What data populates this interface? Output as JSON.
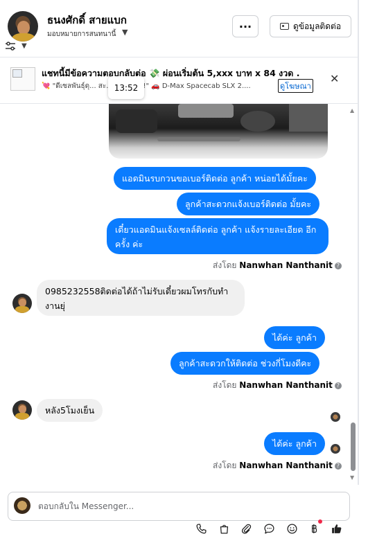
{
  "header": {
    "name": "ธนงศักดิ์ สายแบก",
    "subtitle": "มอบหมายการสนทนานี้",
    "more_label": "···",
    "contact_label": "ดูข้อมูลติดต่อ"
  },
  "ad": {
    "title": "แชทนี้มีข้อความตอบกลับต่อ 💸 ผ่อนเริ่มต้น 5,xxx บาท x 84 งวด .",
    "subtitle": "💘 \"ดีเซลพันธุ์ดุ... สะ... ...ค้าดูถูก!\" 🚗 D-Max Spacecab SLX 2....",
    "link_label": "ดูโฆษณา",
    "close_label": "✕",
    "tooltip_time": "13:52"
  },
  "messages": {
    "out1": "แอดมินรบกวนขอเบอร์ติดต่อ ลูกค้า หน่อยได้มั้ยคะ",
    "out2": "ลูกค้าสะดวกแจ้งเบอร์ติดต่อ มั้ยคะ",
    "out3": "เดี๋ยวแอดมินแจ้งเซลล์ติดต่อ ลูกค้า แจ้งรายละเอียด อีกครั้ง ค่ะ",
    "in1": "0985232558ติดต่อได้ถ้าไม่รับเดี๋ยวผมโทรกับทำงานยุ่",
    "out4": "ได้ค่ะ  ลูกค้า",
    "out5": "ลูกค้าสะดวกให้ติดต่อ ช่วงกี่โมงดีคะ",
    "in2": "หลัง5โมงเย็น",
    "out6": "ได้ค่ะ  ลูกค้า"
  },
  "sent_by": {
    "prefix": "ส่งโดย",
    "agent": "Nanwhan Nanthanit"
  },
  "composer": {
    "placeholder": "ตอบกลับใน Messenger..."
  },
  "toolbar_icons": [
    "phone-icon",
    "shopping-bag-icon",
    "paperclip-icon",
    "chat-bubble-icon",
    "smiley-icon",
    "baht-icon",
    "thumbs-up-icon"
  ],
  "colors": {
    "outgoing_bubble": "#0a7cff",
    "incoming_bubble": "#f0f0f0",
    "notification_dot": "#f02849"
  }
}
